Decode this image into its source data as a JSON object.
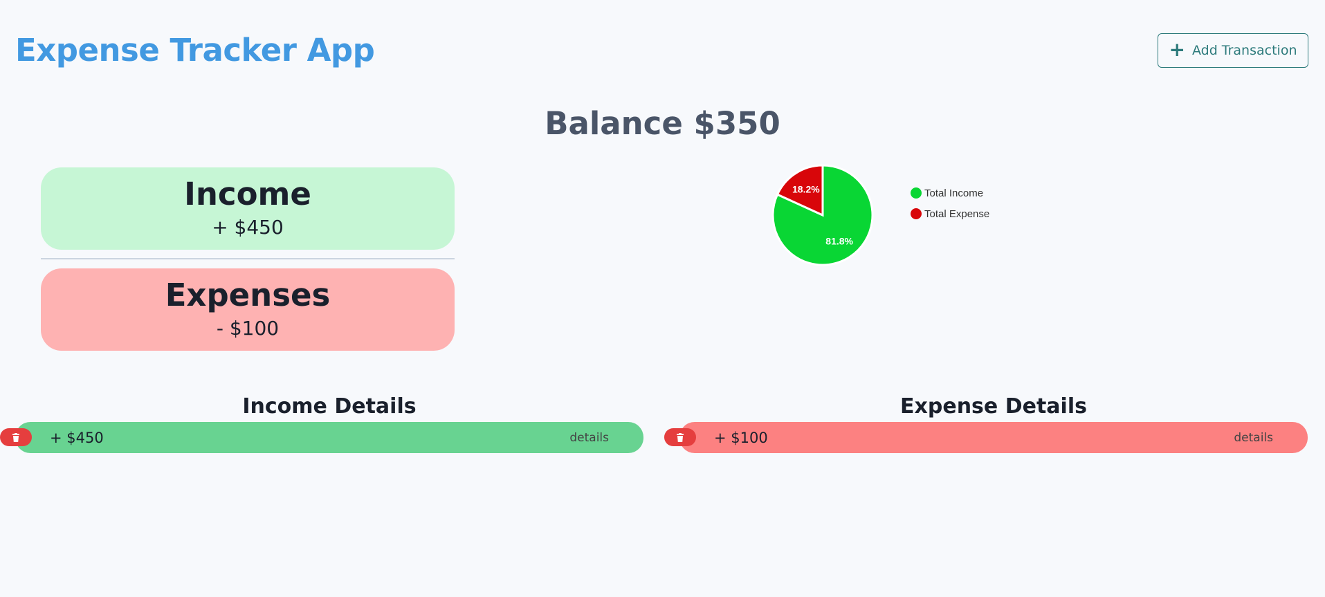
{
  "header": {
    "title": "Expense Tracker App",
    "add_button_label": "Add Transaction",
    "add_icon": "plus-icon"
  },
  "balance": {
    "text": "Balance $350"
  },
  "summary": {
    "income_label": "Income",
    "income_amount": "+ $450",
    "expense_label": "Expenses",
    "expense_amount": "- $100"
  },
  "chart_data": {
    "type": "pie",
    "slices": [
      {
        "label": "Total Income",
        "value": 450,
        "percent_label": "81.8%",
        "color": "#09d634"
      },
      {
        "label": "Total Expense",
        "value": 100,
        "percent_label": "18.2%",
        "color": "#d8060a"
      }
    ],
    "legend_position": "right"
  },
  "income_details": {
    "title": "Income Details",
    "rows": [
      {
        "amount": "+ $450",
        "details_label": "details"
      }
    ]
  },
  "expense_details": {
    "title": "Expense Details",
    "rows": [
      {
        "amount": "+ $100",
        "details_label": "details"
      }
    ]
  },
  "icons": {
    "delete": "trash-icon"
  },
  "colors": {
    "title_blue": "#4299e1",
    "accent_teal": "#2c7a7b",
    "income_card": "#c6f6d5",
    "expense_card": "#feb2b2",
    "income_row": "#68d391",
    "expense_row": "#fc8181",
    "delete_red": "#e53e3e"
  }
}
